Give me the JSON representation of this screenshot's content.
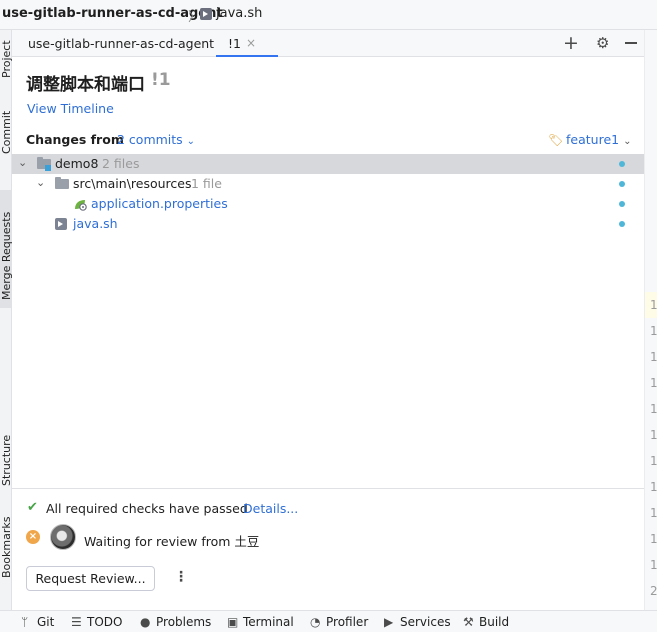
{
  "breadcrumb": {
    "project": "use-gitlab-runner-as-cd-agent",
    "separator": "〉",
    "file": "java.sh"
  },
  "left_tool_tabs": [
    "Project",
    "Commit",
    "Merge Requests",
    "Structure",
    "Bookmarks"
  ],
  "tabs": {
    "main": "use-gitlab-runner-as-cd-agent",
    "mr": "!1",
    "close": "×",
    "plus": "+",
    "gear": "⚙"
  },
  "mr": {
    "title": "调整脚本和端口",
    "number": "!1",
    "view_timeline": "View Timeline",
    "changes_from": "Changes from",
    "commits": "2 commits",
    "branch": "feature1"
  },
  "tree": [
    {
      "name": "demo8",
      "meta": "2 files"
    },
    {
      "name": "src\\main\\resources",
      "meta": "1 file"
    },
    {
      "name": "application.properties",
      "meta": ""
    },
    {
      "name": "java.sh",
      "meta": ""
    }
  ],
  "review": {
    "checks": "All required checks have passed",
    "details": "Details...",
    "waiting": "Waiting for review from 土豆",
    "request_button": "Request Review...",
    "more": "⋮"
  },
  "right_gutter_numbers": [
    "1",
    "1",
    "1",
    "1",
    "1",
    "1",
    "1",
    "1",
    "1",
    "1",
    "1",
    "2",
    "2"
  ],
  "status_bar": [
    {
      "icon": "git-branch-icon",
      "glyph": "ᛘ",
      "label": "Git"
    },
    {
      "icon": "todo-list-icon",
      "glyph": "☰",
      "label": "TODO"
    },
    {
      "icon": "problems-icon",
      "glyph": "●",
      "label": "Problems"
    },
    {
      "icon": "terminal-icon",
      "glyph": "▣",
      "label": "Terminal"
    },
    {
      "icon": "profiler-icon",
      "glyph": "◔",
      "label": "Profiler"
    },
    {
      "icon": "services-icon",
      "glyph": "▶",
      "label": "Services"
    },
    {
      "icon": "build-hammer-icon",
      "glyph": "⚒",
      "label": "Build"
    }
  ],
  "colors": {
    "link": "#2f6fd5",
    "accent_tab": "#3574f0",
    "check": "#47a447",
    "pending": "#f0a64a",
    "modified_dot": "#4fb6d8",
    "selected_row": "#d6d8dc"
  }
}
